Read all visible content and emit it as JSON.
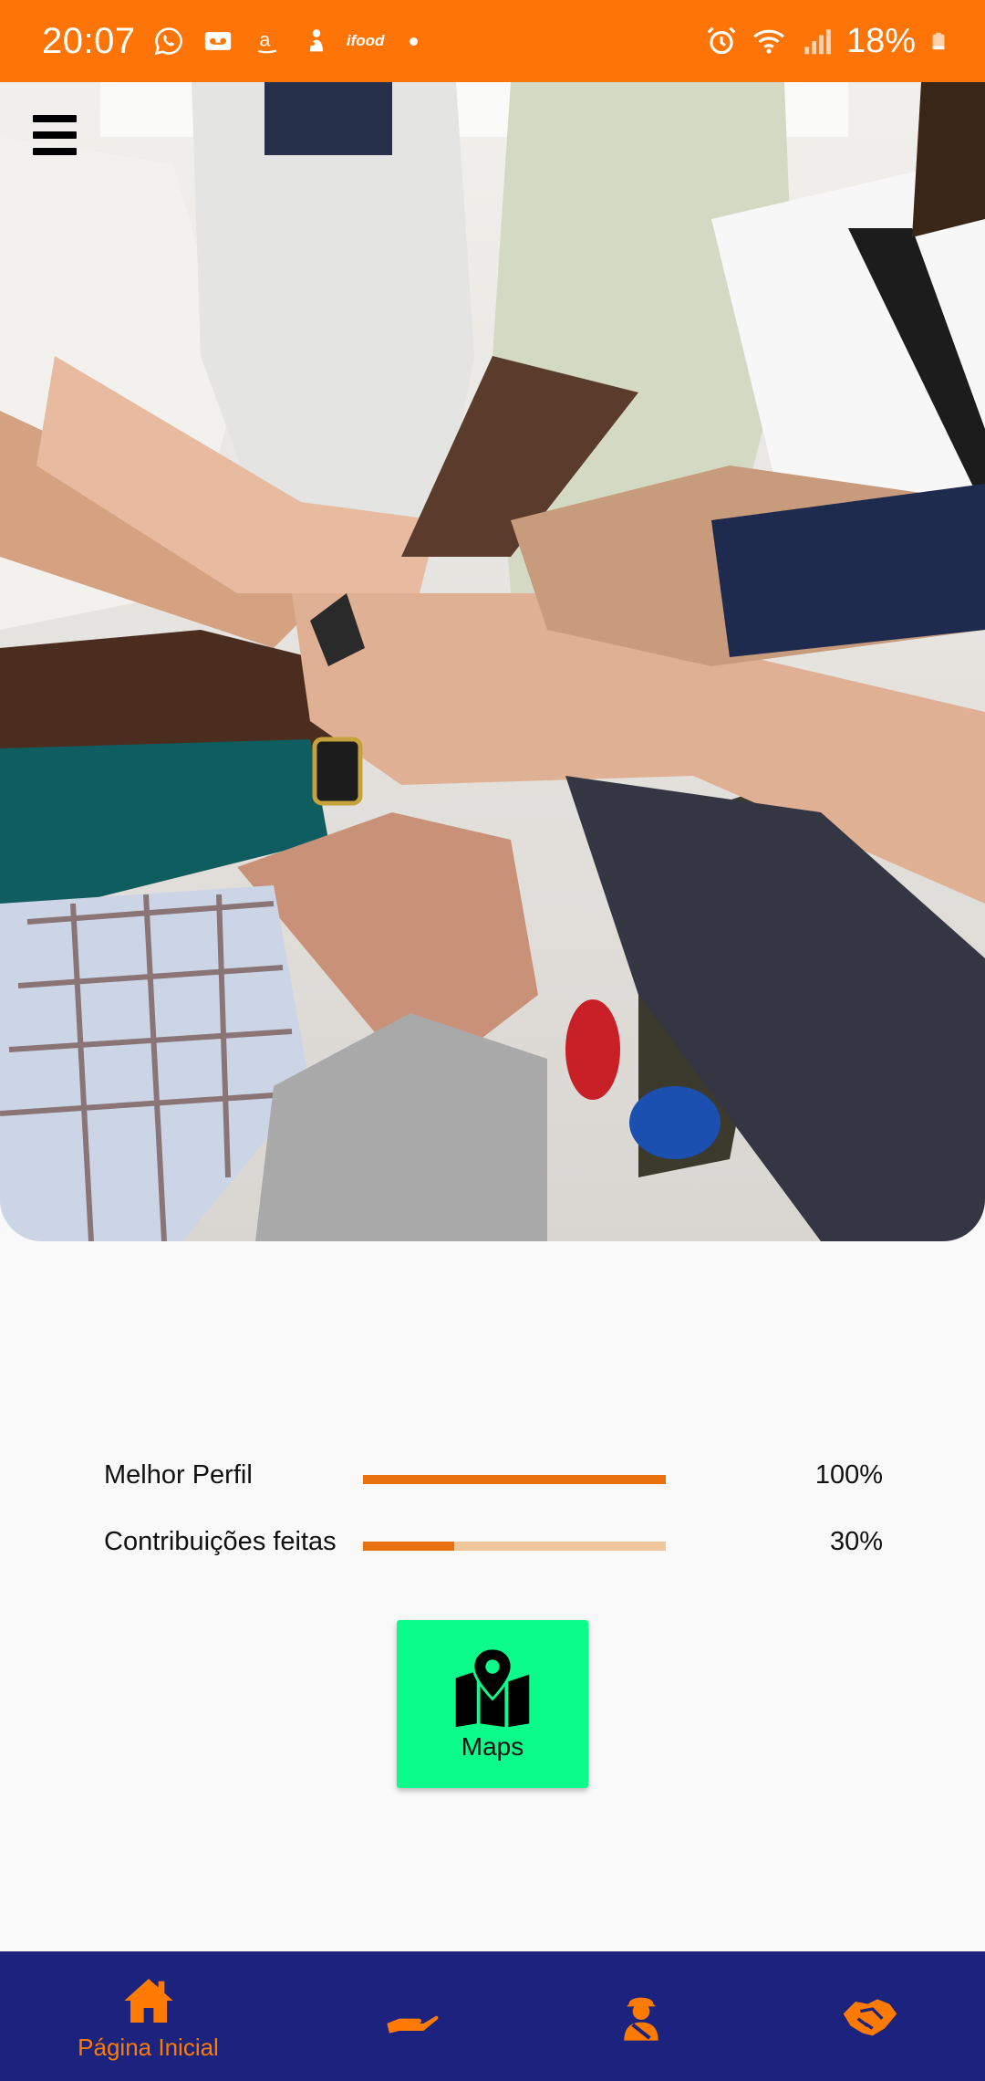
{
  "status_bar": {
    "time": "20:07",
    "notifications": [
      "whatsapp-icon",
      "voicemail-icon",
      "amazon-icon",
      "pet-icon",
      "ifood-icon",
      "dot"
    ],
    "ifood_text": "ifood",
    "system_icons": [
      "alarm-icon",
      "wifi-icon",
      "signal-icon",
      "battery-icon"
    ],
    "battery": "18%"
  },
  "colors": {
    "status_bar": "#ff7406",
    "accent": "#e8700f",
    "track": "#f0c79d",
    "maps_button": "#0bfc8a",
    "nav_background": "#1b237e",
    "nav_icon": "#ff7a00"
  },
  "hero": {
    "image": "group of people stacking hands together",
    "menu_icon": "hamburger-menu-icon"
  },
  "stats": [
    {
      "label": "Melhor Perfil",
      "value_text": "100%",
      "fraction": 1.0
    },
    {
      "label": "Contribuições feitas",
      "value_text": "30%",
      "fraction": 0.3
    }
  ],
  "maps_button": {
    "label": "Maps",
    "icon": "map-pin-icon"
  },
  "bottom_nav": {
    "items": [
      {
        "icon": "home-icon",
        "label": "Página Inicial",
        "active": true
      },
      {
        "icon": "giving-hand-icon",
        "label": ""
      },
      {
        "icon": "worker-icon",
        "label": ""
      },
      {
        "icon": "handshake-icon",
        "label": ""
      }
    ]
  }
}
